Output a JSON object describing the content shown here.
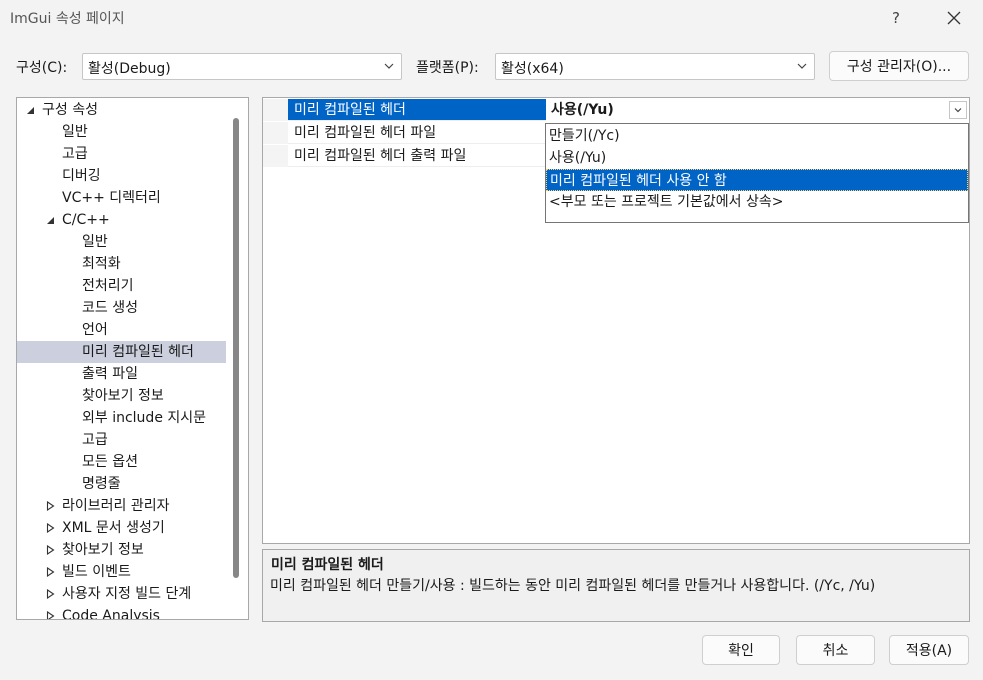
{
  "window": {
    "title": "ImGui 속성 페이지",
    "help": "?",
    "close": "✕"
  },
  "config": {
    "config_label": "구성(C):",
    "config_value": "활성(Debug)",
    "platform_label": "플랫폼(P):",
    "platform_value": "활성(x64)",
    "manager_button": "구성 관리자(O)..."
  },
  "tree": [
    {
      "label": "구성 속성",
      "expander": "expanded"
    },
    {
      "label": "일반"
    },
    {
      "label": "고급"
    },
    {
      "label": "디버깅"
    },
    {
      "label": "VC++ 디렉터리"
    },
    {
      "label": "C/C++",
      "expander": "expanded"
    },
    {
      "label": "일반"
    },
    {
      "label": "최적화"
    },
    {
      "label": "전처리기"
    },
    {
      "label": "코드 생성"
    },
    {
      "label": "언어"
    },
    {
      "label": "미리 컴파일된 헤더",
      "selected": true
    },
    {
      "label": "출력 파일"
    },
    {
      "label": "찾아보기 정보"
    },
    {
      "label": "외부 include 지시문"
    },
    {
      "label": "고급"
    },
    {
      "label": "모든 옵션"
    },
    {
      "label": "명령줄"
    },
    {
      "label": "라이브러리 관리자",
      "expander": "collapsed"
    },
    {
      "label": "XML 문서 생성기",
      "expander": "collapsed"
    },
    {
      "label": "찾아보기 정보",
      "expander": "collapsed"
    },
    {
      "label": "빌드 이벤트",
      "expander": "collapsed"
    },
    {
      "label": "사용자 지정 빌드 단계",
      "expander": "collapsed"
    },
    {
      "label": "Code Analysis",
      "expander": "collapsed"
    }
  ],
  "properties": [
    {
      "name": "미리 컴파일된 헤더",
      "value": "사용(/Yu)",
      "selected": true
    },
    {
      "name": "미리 컴파일된 헤더 파일",
      "value": ""
    },
    {
      "name": "미리 컴파일된 헤더 출력 파일",
      "value": ""
    }
  ],
  "dropdown": [
    {
      "label": "만들기(/Yc)"
    },
    {
      "label": "사용(/Yu)"
    },
    {
      "label": "미리 컴파일된 헤더 사용 안 함",
      "selected": true
    },
    {
      "label": "<부모 또는 프로젝트 기본값에서 상속>"
    }
  ],
  "description": {
    "title": "미리 컴파일된 헤더",
    "text": "미리 컴파일된 헤더 만들기/사용 : 빌드하는 동안 미리 컴파일된 헤더를 만들거나 사용합니다.     (/Yc, /Yu)"
  },
  "buttons": {
    "ok": "확인",
    "cancel": "취소",
    "apply": "적용(A)"
  },
  "colors": {
    "selection": "#0063c6",
    "tree_selection": "#ccd0de"
  }
}
